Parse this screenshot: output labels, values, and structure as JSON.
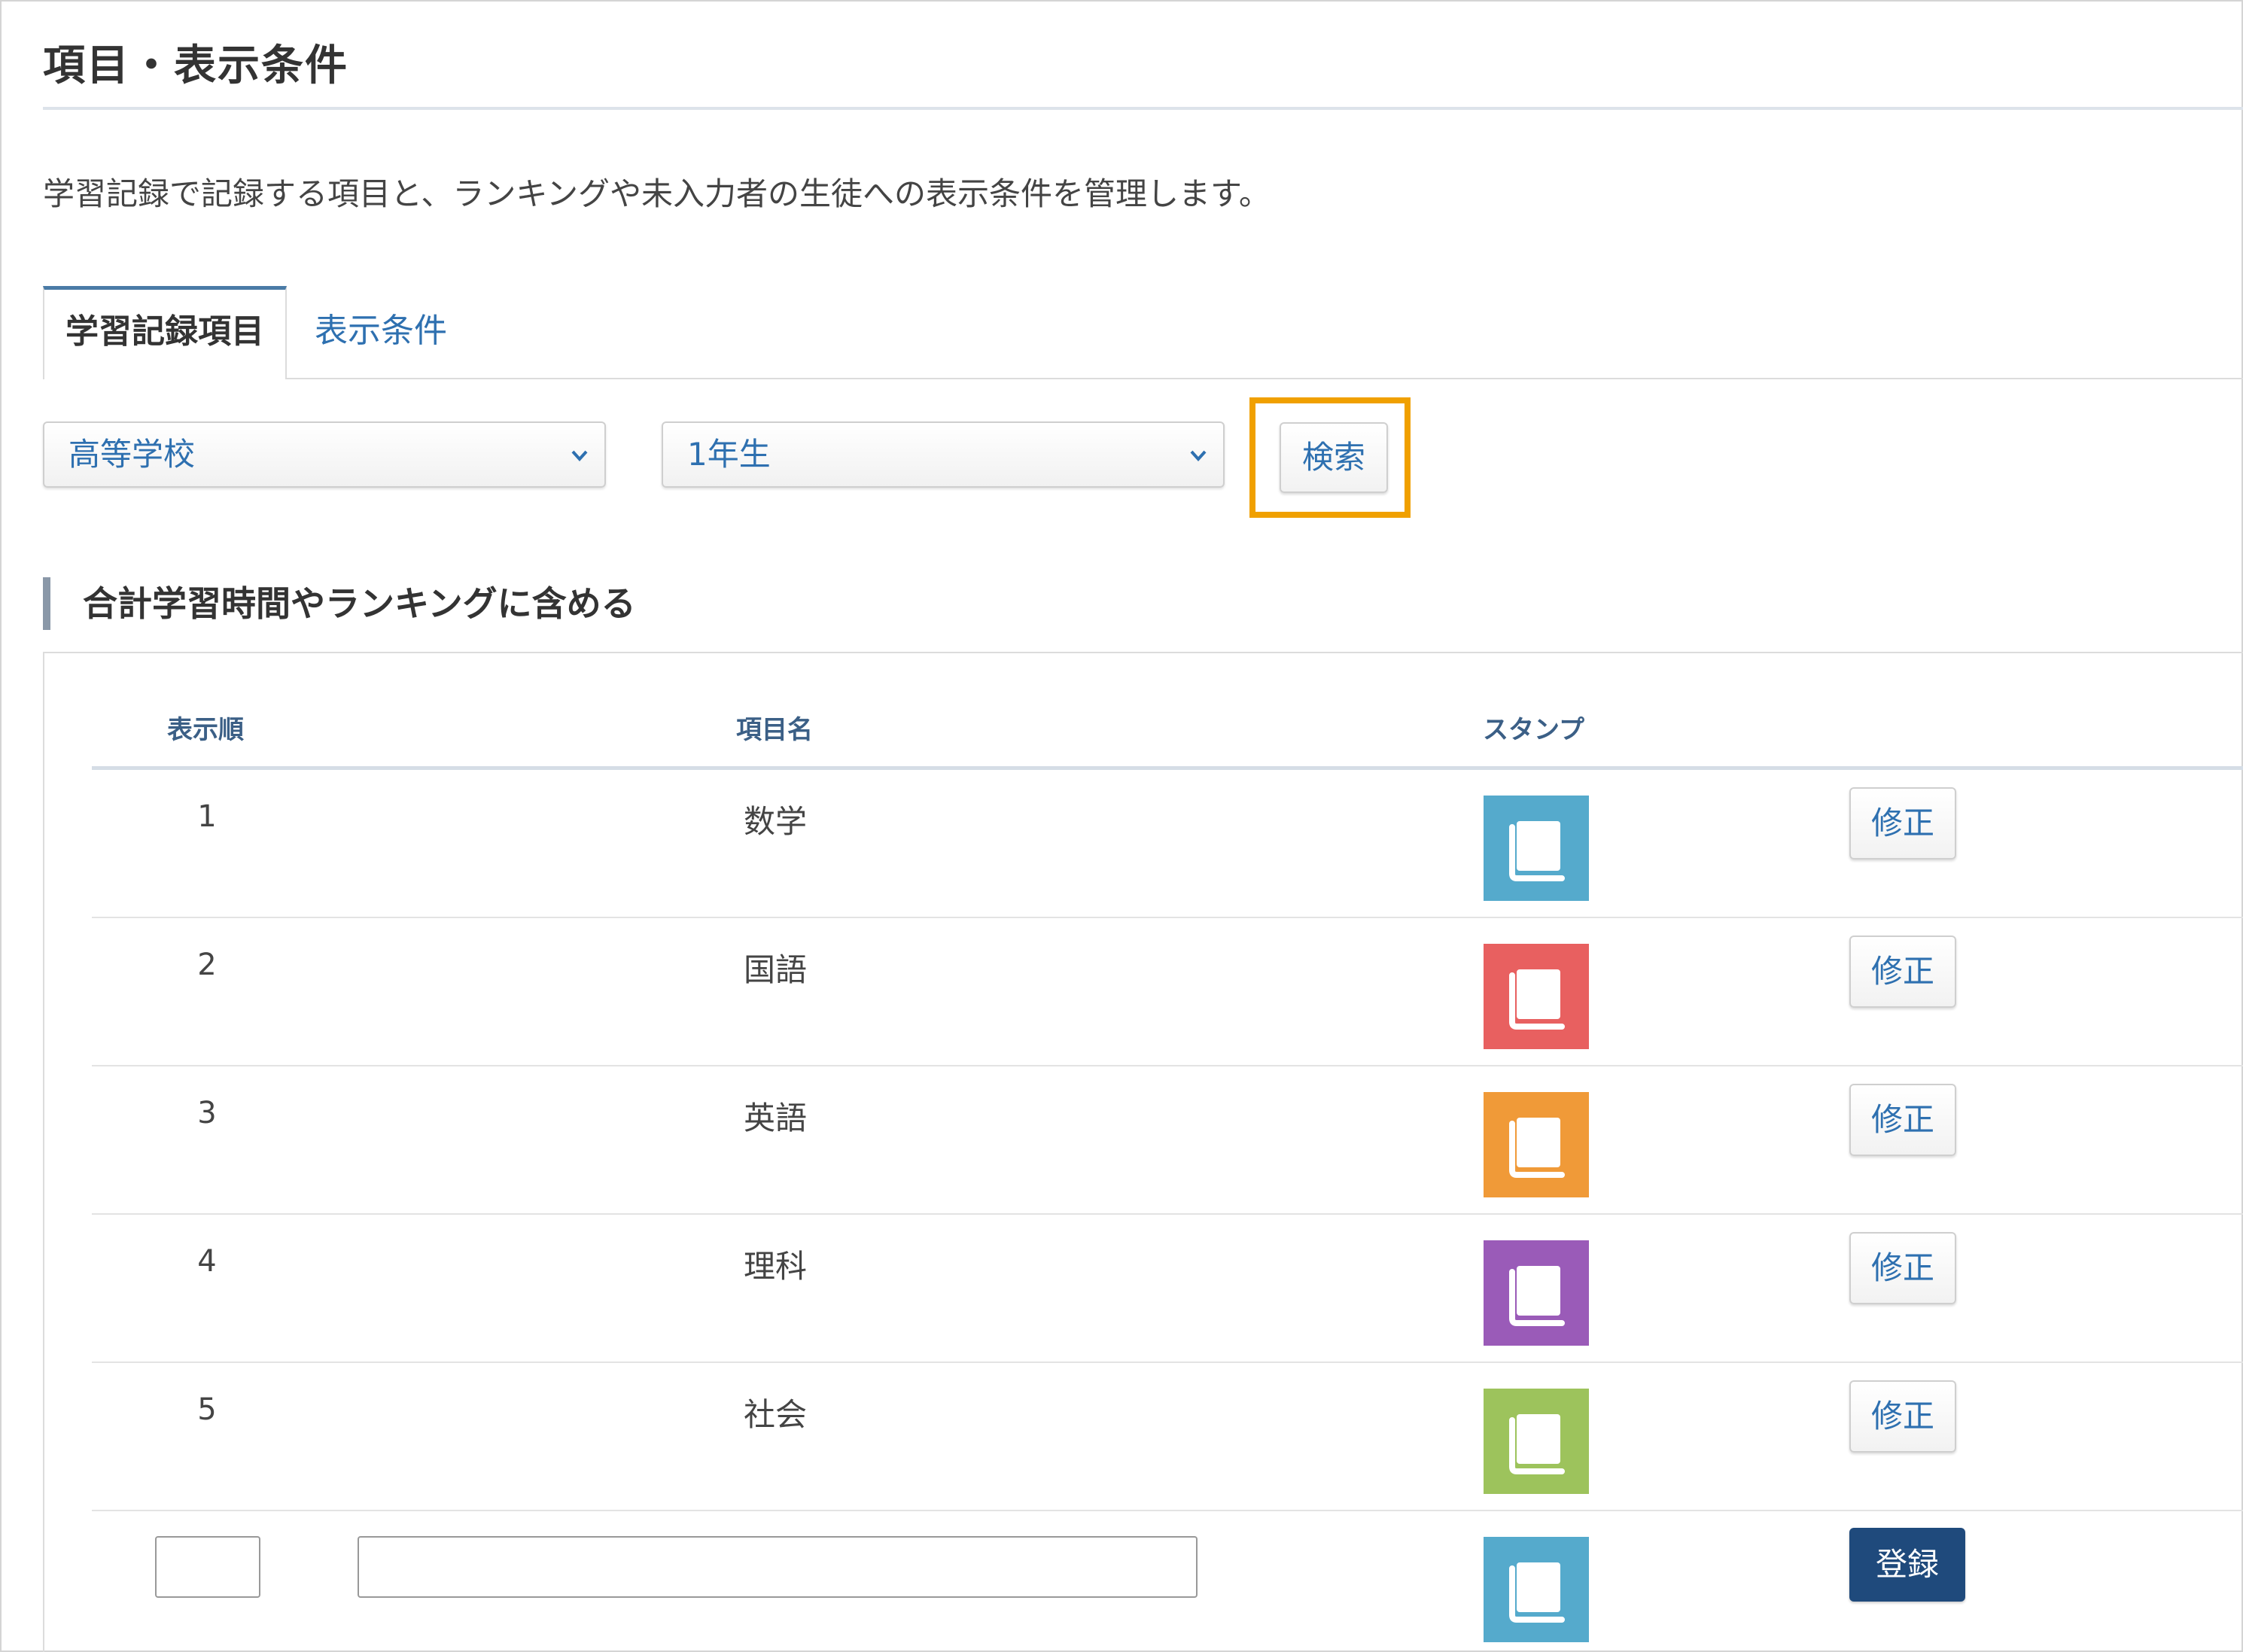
{
  "page": {
    "title": "項目・表示条件",
    "description": "学習記録で記録する項目と、ランキングや未入力者の生徒への表示条件を管理します。"
  },
  "tabs": [
    {
      "label": "学習記録項目",
      "active": true
    },
    {
      "label": "表示条件",
      "active": false
    }
  ],
  "filters": {
    "school": {
      "value": "高等学校"
    },
    "grade": {
      "value": "1年生"
    },
    "search_label": "検索"
  },
  "section": {
    "title": "合計学習時間やランキングに含める"
  },
  "table": {
    "headers": {
      "order": "表示順",
      "name": "項目名",
      "stamp": "スタンプ"
    },
    "rows": [
      {
        "order": "1",
        "name": "数学",
        "stamp_color": "#55aacc",
        "edit_label": "修正"
      },
      {
        "order": "2",
        "name": "国語",
        "stamp_color": "#e86060",
        "edit_label": "修正"
      },
      {
        "order": "3",
        "name": "英語",
        "stamp_color": "#f09a38",
        "edit_label": "修正"
      },
      {
        "order": "4",
        "name": "理科",
        "stamp_color": "#9a5bb8",
        "edit_label": "修正"
      },
      {
        "order": "5",
        "name": "社会",
        "stamp_color": "#9dc35c",
        "edit_label": "修正"
      }
    ],
    "new_row": {
      "order_value": "",
      "name_value": "",
      "stamp_color": "#55aacc",
      "register_label": "登録"
    }
  },
  "colors": {
    "accent": "#2e70b0",
    "highlight": "#f0a000",
    "primary_button": "#1f4a7c"
  }
}
